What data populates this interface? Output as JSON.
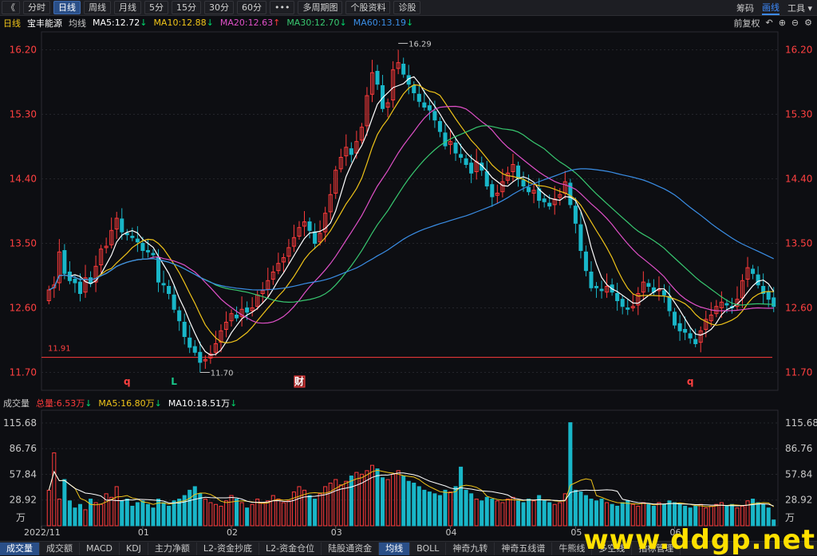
{
  "toolbar": {
    "back_glyph": "《",
    "tabs": [
      "分时",
      "日线",
      "周线",
      "月线",
      "5分",
      "15分",
      "30分",
      "60分",
      "•••",
      "多周期图",
      "个股资料",
      "诊股"
    ],
    "active_tab": 1,
    "right": [
      "筹码",
      "画线",
      "工具 ▾"
    ]
  },
  "legend": {
    "period": "日线",
    "name": "宝丰能源",
    "ma_label": "均线",
    "items": [
      {
        "text": "MA5:12.72",
        "arrow": "↓",
        "color": "#ffffff",
        "arrow_color": "#00d26a"
      },
      {
        "text": "MA10:12.88",
        "arrow": "↓",
        "color": "#f0c419",
        "arrow_color": "#00d26a"
      },
      {
        "text": "MA20:12.63",
        "arrow": "↑",
        "color": "#e050c8",
        "arrow_color": "#ff3b3b"
      },
      {
        "text": "MA30:12.70",
        "arrow": "↓",
        "color": "#38c870",
        "arrow_color": "#00d26a"
      },
      {
        "text": "MA60:13.19",
        "arrow": "↓",
        "color": "#3a8ee6",
        "arrow_color": "#00d26a"
      }
    ],
    "adjust": "前复权",
    "icons": [
      "undo-icon",
      "zoom-in-icon",
      "zoom-out-icon",
      "gear-icon"
    ]
  },
  "vol_legend": {
    "title": "成交量",
    "items": [
      {
        "text": "总量:6.53万",
        "arrow": "↓",
        "color": "#ff3b3b"
      },
      {
        "text": "MA5:16.80万",
        "arrow": "↓",
        "color": "#f0c419"
      },
      {
        "text": "MA10:18.51万",
        "arrow": "↓",
        "color": "#ffffff"
      }
    ]
  },
  "bottom_tabs": [
    "成交量",
    "成交额",
    "MACD",
    "KDJ",
    "主力净额",
    "L2-资金抄底",
    "L2-资金仓位",
    "陆股通资金",
    "均线",
    "BOLL",
    "神奇九转",
    "神奇五线谱",
    "牛熊线",
    "多空线",
    "指标管理"
  ],
  "bottom_active": [
    0,
    8
  ],
  "watermark": "www.ddgp.net",
  "chart_data": [
    {
      "type": "candlestick",
      "title": "日线",
      "yticks": [
        "16.20",
        "15.30",
        "14.40",
        "13.50",
        "12.60",
        "11.70"
      ],
      "ylim": [
        11.7,
        16.2
      ],
      "xticks": [
        "2022/11",
        "01",
        "02",
        "03",
        "04",
        "05",
        "06"
      ],
      "annotations": {
        "high": "16.29",
        "low": "11.70",
        "support_line": "11.91",
        "markers": [
          "q",
          "L",
          "财",
          "q"
        ]
      },
      "ma_last": {
        "MA5": 12.72,
        "MA10": 12.88,
        "MA20": 12.63,
        "MA30": 12.7,
        "MA60": 13.19
      },
      "series_colors": {
        "up": "#ff3b3b",
        "down": "#19b6c8"
      },
      "closes": [
        12.85,
        12.92,
        13.38,
        13.08,
        12.98,
        12.95,
        12.8,
        13.02,
        12.94,
        13.18,
        13.42,
        13.46,
        13.68,
        13.85,
        13.66,
        13.62,
        13.58,
        13.52,
        13.4,
        13.38,
        13.34,
        12.96,
        12.92,
        12.8,
        12.58,
        12.42,
        12.2,
        12.05,
        11.98,
        11.84,
        11.88,
        11.96,
        12.1,
        12.28,
        12.4,
        12.52,
        12.46,
        12.58,
        12.54,
        12.6,
        12.78,
        12.84,
        12.98,
        13.1,
        13.22,
        13.3,
        13.44,
        13.58,
        13.72,
        13.8,
        13.68,
        13.5,
        13.64,
        13.92,
        14.18,
        14.52,
        14.7,
        14.84,
        14.74,
        14.92,
        15.12,
        15.56,
        15.88,
        15.72,
        15.38,
        15.46,
        15.92,
        16.02,
        15.86,
        15.72,
        15.6,
        15.48,
        15.4,
        15.36,
        15.22,
        15.06,
        14.86,
        14.92,
        14.76,
        14.7,
        14.6,
        14.48,
        14.64,
        14.52,
        14.3,
        14.15,
        14.2,
        14.36,
        14.48,
        14.6,
        14.4,
        14.3,
        14.22,
        14.24,
        14.1,
        14.08,
        14.02,
        14.12,
        14.18,
        14.36,
        14.04,
        13.78,
        13.4,
        13.12,
        12.88,
        12.88,
        12.84,
        12.9,
        12.82,
        12.7,
        12.62,
        12.58,
        12.62,
        12.8,
        12.96,
        12.9,
        12.82,
        12.86,
        12.78,
        12.56,
        12.36,
        12.28,
        12.26,
        12.18,
        12.1,
        12.28,
        12.44,
        12.5,
        12.62,
        12.68,
        12.64,
        12.6,
        12.72,
        12.98,
        13.16,
        13.08,
        12.92,
        12.8,
        12.72,
        12.62
      ],
      "opens": [
        12.7,
        12.88,
        12.95,
        13.4,
        13.1,
        13.0,
        12.96,
        12.82,
        13.02,
        12.96,
        13.2,
        13.44,
        13.48,
        13.7,
        13.84,
        13.64,
        13.6,
        13.56,
        13.5,
        13.4,
        13.36,
        13.3,
        12.94,
        12.9,
        12.78,
        12.56,
        12.4,
        12.18,
        12.06,
        11.98,
        11.86,
        11.9,
        11.98,
        12.12,
        12.3,
        12.42,
        12.5,
        12.48,
        12.6,
        12.56,
        12.62,
        12.8,
        12.86,
        13.0,
        13.12,
        13.24,
        13.32,
        13.46,
        13.6,
        13.74,
        13.8,
        13.66,
        13.52,
        13.66,
        13.94,
        14.2,
        14.54,
        14.72,
        14.82,
        14.76,
        14.94,
        15.14,
        15.58,
        15.9,
        15.7,
        15.4,
        15.5,
        15.94,
        16.0,
        15.84,
        15.7,
        15.58,
        15.46,
        15.42,
        15.34,
        15.2,
        15.04,
        14.88,
        14.9,
        14.74,
        14.68,
        14.62,
        14.5,
        14.62,
        14.5,
        14.32,
        14.17,
        14.22,
        14.38,
        14.5,
        14.58,
        14.38,
        14.28,
        14.2,
        14.26,
        14.12,
        14.06,
        14.04,
        14.14,
        14.2,
        14.34,
        14.02,
        13.76,
        13.38,
        13.1,
        12.9,
        12.86,
        12.82,
        12.92,
        12.8,
        12.72,
        12.6,
        12.6,
        12.64,
        12.82,
        12.94,
        12.88,
        12.84,
        12.84,
        12.76,
        12.54,
        12.38,
        12.3,
        12.24,
        12.16,
        12.12,
        12.3,
        12.42,
        12.52,
        12.6,
        12.66,
        12.62,
        12.62,
        12.74,
        13.0,
        13.14,
        13.06,
        12.9,
        12.82,
        12.74
      ],
      "volume_ticks": [
        "115.68",
        "86.76",
        "57.84",
        "28.92"
      ],
      "volume_unit": "万",
      "volumes": [
        40,
        82,
        30,
        52,
        28,
        20,
        24,
        18,
        30,
        26,
        24,
        36,
        32,
        44,
        28,
        30,
        22,
        26,
        28,
        24,
        20,
        30,
        26,
        22,
        28,
        30,
        34,
        40,
        44,
        36,
        30,
        26,
        24,
        22,
        28,
        34,
        30,
        26,
        20,
        24,
        30,
        26,
        28,
        34,
        30,
        26,
        28,
        38,
        44,
        40,
        34,
        30,
        36,
        44,
        48,
        52,
        46,
        50,
        56,
        60,
        58,
        62,
        68,
        64,
        54,
        52,
        58,
        62,
        56,
        50,
        48,
        44,
        40,
        38,
        36,
        34,
        40,
        38,
        44,
        66,
        40,
        36,
        30,
        28,
        32,
        30,
        28,
        26,
        30,
        32,
        28,
        26,
        30,
        28,
        34,
        28,
        26,
        24,
        26,
        36,
        116,
        40,
        38,
        34,
        30,
        28,
        30,
        26,
        24,
        22,
        26,
        28,
        24,
        22,
        26,
        24,
        22,
        26,
        24,
        28,
        26,
        24,
        22,
        20,
        22,
        24,
        20,
        22,
        24,
        26,
        22,
        24,
        20,
        22,
        28,
        30,
        26,
        24,
        20,
        6.53
      ]
    }
  ]
}
